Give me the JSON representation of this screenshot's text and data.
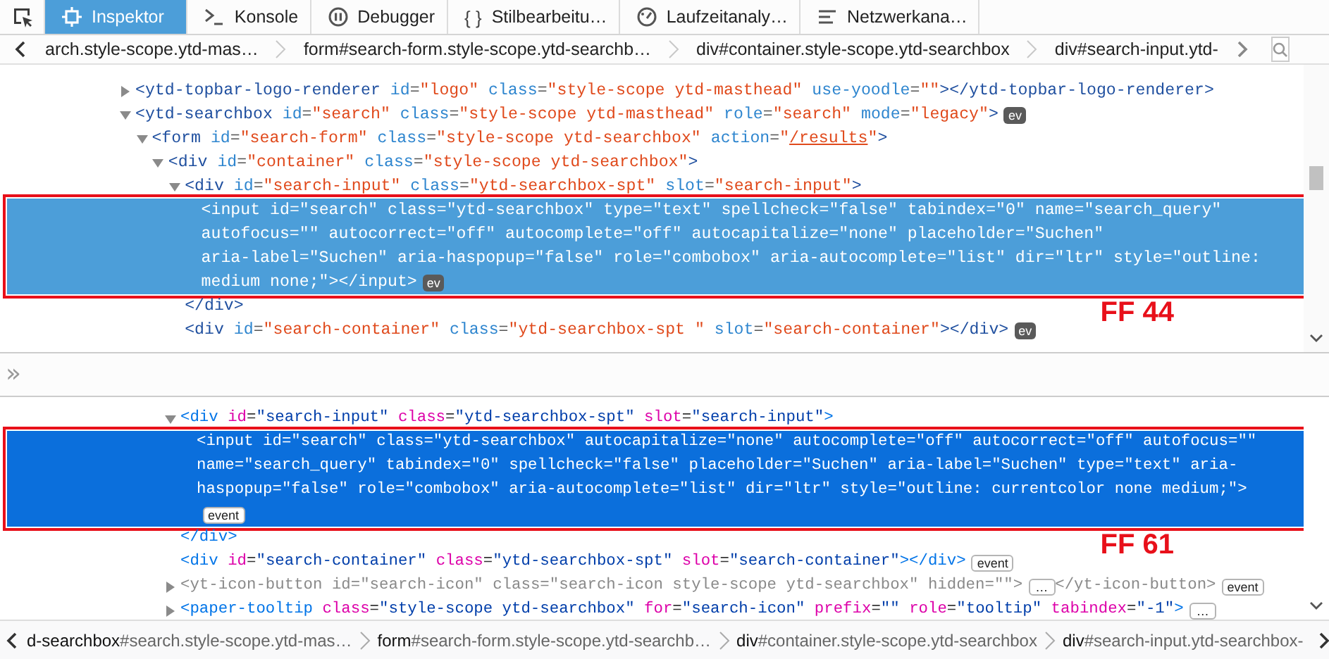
{
  "panels": [
    {
      "kind": "classic",
      "tabs": [
        {
          "label": "Inspektor",
          "selected": true
        },
        {
          "label": "Konsole",
          "selected": false
        },
        {
          "label": "Debugger",
          "selected": false
        },
        {
          "label": "Stilbearbeitu…",
          "glyph": "{ }",
          "selected": false
        },
        {
          "label": "Laufzeitanaly…",
          "selected": false
        },
        {
          "label": "Netzwerkana…",
          "selected": false
        }
      ],
      "breadcrumbs": [
        {
          "text": "arch.style-scope.ytd-mas…"
        },
        {
          "text": "form#search-form.style-scope.ytd-searchb…"
        },
        {
          "text": "div#container.style-scope.ytd-searchbox"
        },
        {
          "text": "div#search-input.ytd-"
        }
      ],
      "tree": [
        {
          "lines": [
            "<ytd-topbar-logo-renderer id=\"logo\" class=\"style-scope ytd-masthead\" use-yoodle=\"\"></ytd-topbar-logo-renderer>"
          ],
          "expanded": false,
          "selected": false
        },
        {
          "lines": [
            [
              "<ytd-searchbox id=\"search\" class=\"style-scope ytd-masthead\" role=\"search\" mode=\"legacy\">",
              {
                "badge": "ev",
                "kind": "event"
              }
            ]
          ],
          "expanded": true,
          "selected": false,
          "children": [
            {
              "lines": [
                [
                  "<form id=\"search-form\" class=\"style-scope ytd-searchbox\" action=\"",
                  {
                    "link": "/results"
                  },
                  "\">"
                ]
              ],
              "expanded": true,
              "selected": false,
              "children": [
                {
                  "lines": [
                    "<div id=\"container\" class=\"style-scope ytd-searchbox\">"
                  ],
                  "expanded": true,
                  "selected": false,
                  "children": [
                    {
                      "lines": [
                        "<div id=\"search-input\" class=\"ytd-searchbox-spt\" slot=\"search-input\">"
                      ],
                      "expanded": true,
                      "selected": false,
                      "close": "</div>",
                      "children": [
                        {
                          "lines": [
                            "<input id=\"search\" class=\"ytd-searchbox\" type=\"text\" spellcheck=\"false\" tabindex=\"0\" name=\"search_query\"",
                            "autofocus=\"\" autocorrect=\"off\" autocomplete=\"off\" autocapitalize=\"none\" placeholder=\"Suchen\"",
                            "aria-label=\"Suchen\" aria-haspopup=\"false\" role=\"combobox\" aria-autocomplete=\"list\" dir=\"ltr\" style=\"outline:",
                            [
                              "medium none;\"></input>",
                              {
                                "badge": "ev",
                                "kind": "event"
                              }
                            ]
                          ],
                          "selected": true
                        }
                      ]
                    },
                    {
                      "lines": [
                        [
                          "<div id=\"search-container\" class=\"ytd-searchbox-spt \" slot=\"search-container\"></div>",
                          {
                            "badge": "ev",
                            "kind": "event"
                          }
                        ]
                      ],
                      "selected": false
                    }
                  ]
                }
              ]
            }
          ]
        }
      ],
      "annotation": {
        "label": "FF 44"
      },
      "console": {
        "prompt": "»"
      }
    },
    {
      "kind": "modern",
      "tree": [
        {
          "lines": [
            "<div id=\"search-input\" class=\"ytd-searchbox-spt\" slot=\"search-input\">"
          ],
          "expanded": true,
          "selected": false,
          "dimmed": false,
          "close": "</div>",
          "children": [
            {
              "lines": [
                "<input id=\"search\" class=\"ytd-searchbox\" autocapitalize=\"none\" autocomplete=\"off\" autocorrect=\"off\" autofocus=\"\"",
                "name=\"search_query\" tabindex=\"0\" spellcheck=\"false\" placeholder=\"Suchen\" aria-label=\"Suchen\" type=\"text\" aria-",
                "haspopup=\"false\" role=\"combobox\" aria-autocomplete=\"list\" dir=\"ltr\" style=\"outline: currentcolor none medium;\">",
                [
                  {
                    "badge": "event",
                    "kind": "event"
                  }
                ]
              ],
              "selected": true
            }
          ]
        },
        {
          "lines": [
            [
              "<div id=\"search-container\" class=\"ytd-searchbox-spt\" slot=\"search-container\"></div>",
              {
                "badge": "event",
                "kind": "event"
              }
            ]
          ],
          "selected": false,
          "dimmed": false
        },
        {
          "lines": [
            [
              "<yt-icon-button id=\"search-icon\" class=\"search-icon style-scope ytd-searchbox\" hidden=\"\">",
              {
                "badge": "…",
                "kind": "more"
              },
              "</yt-icon-button>",
              {
                "badge": "event",
                "kind": "event"
              }
            ]
          ],
          "expanded": false,
          "selected": false,
          "dimmed": true
        },
        {
          "lines": [
            [
              "<paper-tooltip class=\"style-scope ytd-searchbox\" for=\"search-icon\" prefix=\"\" role=\"tooltip\" tabindex=\"-1\">",
              {
                "badge": "…",
                "kind": "more"
              }
            ]
          ],
          "expanded": false,
          "selected": false,
          "dimmed": false
        }
      ],
      "annotation": {
        "label": "FF 61"
      },
      "breadcrumbs": [
        {
          "tag": "d-searchbox",
          "rest": "#search.style-scope.ytd-mas…"
        },
        {
          "tag": "form",
          "rest": "#search-form.style-scope.ytd-searchb…"
        },
        {
          "tag": "div",
          "rest": "#container.style-scope.ytd-searchbox"
        },
        {
          "tag": "div",
          "rest": "#search-input.ytd-searchbox-"
        }
      ]
    }
  ]
}
